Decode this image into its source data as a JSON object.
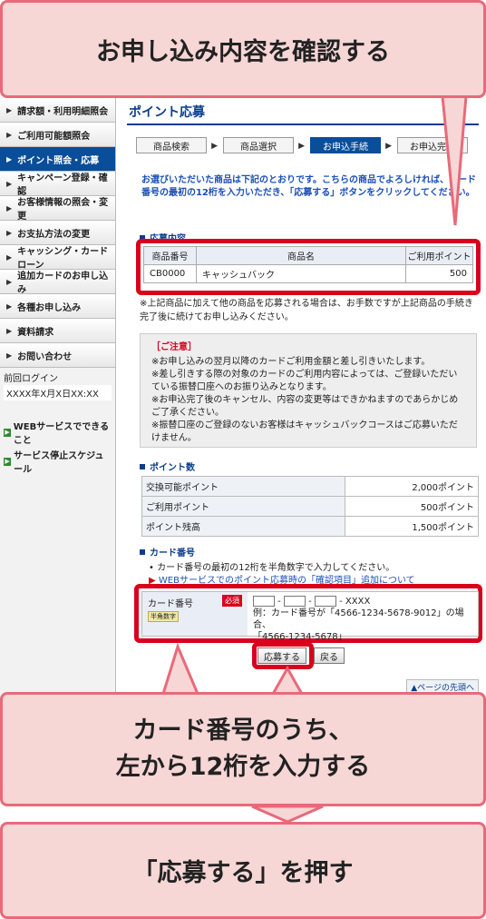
{
  "callouts": {
    "top": "お申し込み内容を確認する",
    "mid_line1": "カード番号のうち、",
    "mid_line2": "左から12桁を入力する",
    "bottom": "「応募する」を押す"
  },
  "sidebar": {
    "items": [
      {
        "label": "請求額・利用明細照会"
      },
      {
        "label": "ご利用可能額照会"
      },
      {
        "label": "ポイント照会・応募"
      },
      {
        "label": "キャンペーン登録・確認"
      },
      {
        "label": "お客様情報の照会・変更"
      },
      {
        "label": "お支払方法の変更"
      },
      {
        "label": "キャッシング・カードローン"
      },
      {
        "label": "追加カードのお申し込み"
      },
      {
        "label": "各種お申し込み"
      },
      {
        "label": "資料請求"
      },
      {
        "label": "お問い合わせ"
      }
    ],
    "last_login_label": "前回ログイン",
    "last_login_value": "XXXX年X月X日XX:XX",
    "links": [
      "WEBサービスでできること",
      "サービス停止スケジュール"
    ]
  },
  "main": {
    "title": "ポイント応募",
    "steps": [
      "商品検索",
      "商品選択",
      "お申込手続",
      "お申込完了"
    ],
    "intro": "お選びいただいた商品は下記のとおりです。こちらの商品でよろしければ、カード番号の最初の12桁を入力いただき、「応募する」ボタンをクリックしてください。",
    "section_apply": "応募内容",
    "product_table": {
      "headers": [
        "商品番号",
        "商品名",
        "ご利用ポイント"
      ],
      "row": [
        "CB0000",
        "キャッシュバック",
        "500"
      ]
    },
    "note1": "※上記商品に加えて他の商品を応募される場合は、お手数ですが上記商品の手続き完了後に続けてお申し込みください。",
    "caution": {
      "title": "［ご注意］",
      "lines": [
        "※お申し込みの翌月以降のカードご利用金額と差し引きいたします。",
        "※差し引きする際の対象のカードのご利用内容によっては、ご登録いただいている振替口座へのお振り込みとなります。",
        "※お申込完了後のキャンセル、内容の変更等はできかねますのであらかじめご了承ください。",
        "※振替口座のご登録のないお客様はキャッシュバックコースはご応募いただけません。"
      ]
    },
    "section_points": "ポイント数",
    "points": [
      {
        "label": "交換可能ポイント",
        "value": "2,000ポイント"
      },
      {
        "label": "ご利用ポイント",
        "value": "500ポイント"
      },
      {
        "label": "ポイント残高",
        "value": "1,500ポイント"
      }
    ],
    "section_card": "カード番号",
    "card_bullet1": "カード番号の最初の12桁を半角数字で入力してください。",
    "card_bullet2": "WEBサービスでのポイント応募時の「確認項目」追加について",
    "card_label": "カード番号",
    "required": "必須",
    "halfwidth": "半角数字",
    "card_suffix": "- XXXX",
    "card_example_1": "例：カード番号が「4566-1234-5678-9012」の場合、",
    "card_example_2": "「4566-1234-5678」",
    "submit_button": "応募する",
    "back_button": "戻る",
    "page_top": "▲ページの先頭へ"
  }
}
